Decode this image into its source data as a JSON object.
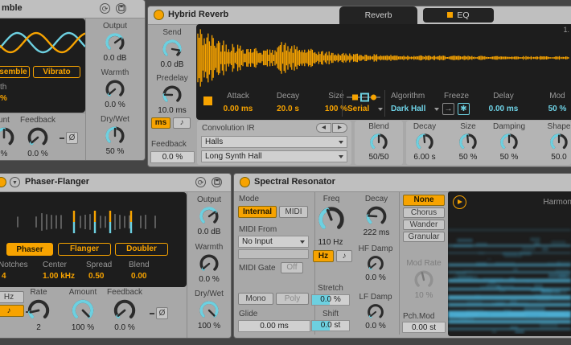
{
  "colors": {
    "orange": "#f7a300",
    "cyan": "#6dd0e0",
    "cyantext": "#6fd4e8",
    "bg": "#454545",
    "surface": "#a8a8a8",
    "titlebar": "#bfbfbf",
    "display": "#1d1d1d",
    "panel": "#b6b6b6",
    "field": "#d0d0d0"
  },
  "icons": {
    "hotswap": "⟳",
    "fold": "▼",
    "conv_prev": "◂",
    "conv_next": "▸"
  },
  "chorus": {
    "title": "mble",
    "ensemble_btn": "semble",
    "vibrato_btn": "Vibrato",
    "width_label": "th",
    "width_value": "%",
    "output": {
      "label": "Output",
      "value": "0.0 dB",
      "frac": 0.7
    },
    "warmth": {
      "label": "Warmth",
      "value": "0.0 %",
      "frac": 0.02
    },
    "drywet": {
      "label": "Dry/Wet",
      "value": "50 %",
      "frac": 0.5
    },
    "amount": {
      "label": "unt",
      "value": "%",
      "frac": 0.5
    },
    "feedback": {
      "label": "Feedback",
      "value": "0.0 %",
      "frac": 0.02
    },
    "phase_btn": "Ø"
  },
  "hybrid": {
    "title": "Hybrid Reverb",
    "tab_reverb": "Reverb",
    "tab_eq": "EQ",
    "send": {
      "label": "Send",
      "value": "0.0 dB",
      "frac": 0.87
    },
    "predelay": {
      "label": "Predelay",
      "value": "10.0 ms",
      "frac": 0.17
    },
    "ms_btn": "ms",
    "note_btn": "♪",
    "feedback_label": "Feedback",
    "feedback_value": "0.0 %",
    "ruler": "1.",
    "attack": {
      "label": "Attack",
      "value": "0.00 ms"
    },
    "decay": {
      "label": "Decay",
      "value": "20.0 s"
    },
    "size": {
      "label": "Size",
      "value": "100 %"
    },
    "routing_value": "Serial",
    "algorithm_label": "Algorithm",
    "algorithm_value": "Dark Hall",
    "freeze_label": "Freeze",
    "route_glyph": "→",
    "freeze_glyph": "✱",
    "delay_label": "Delay",
    "delay_value": "0.00 ms",
    "mod_label": "Mod",
    "mod_value": "50 %",
    "conv_label": "Convolution IR",
    "conv_category": "Halls",
    "conv_file": "Long Synth Hall",
    "blend": {
      "label": "Blend",
      "value": "50/50",
      "frac": 0.5
    },
    "decay2": {
      "label": "Decay",
      "value": "6.00 s",
      "frac": 0.48
    },
    "size2": {
      "label": "Size",
      "value": "50 %",
      "frac": 0.48
    },
    "damping": {
      "label": "Damping",
      "value": "50 %",
      "frac": 0.5
    },
    "shape": {
      "label": "Shape",
      "value": "50.0",
      "frac": 0.5
    }
  },
  "phaser": {
    "title": "Phaser-Flanger",
    "mode_phaser": "Phaser",
    "mode_flanger": "Flanger",
    "mode_doubler": "Doubler",
    "notches_label": "Notches",
    "notches_value": "4",
    "center_label": "Center",
    "center_value": "1.00 kHz",
    "spread_label": "Spread",
    "spread_value": "0.50",
    "blend_label": "Blend",
    "blend_value": "0.00",
    "hz_btn": "Hz",
    "note_btn": "♪",
    "rate": {
      "label": "Rate",
      "value": "2",
      "frac": 0.12
    },
    "amount": {
      "label": "Amount",
      "value": "100 %",
      "frac": 1
    },
    "feedback": {
      "label": "Feedback",
      "value": "0.0 %",
      "frac": 0.02
    },
    "phase_btn": "Ø",
    "output": {
      "label": "Output",
      "value": "0.0 dB",
      "frac": 0.7
    },
    "warmth": {
      "label": "Warmth",
      "value": "0.0 %",
      "frac": 0.02
    },
    "drywet": {
      "label": "Dry/Wet",
      "value": "100 %",
      "frac": 1
    }
  },
  "spectral": {
    "title": "Spectral Resonator",
    "mode_label": "Mode",
    "internal_btn": "Internal",
    "midi_btn": "MIDI",
    "midifrom_label": "MIDI From",
    "midifrom_value": "No Input",
    "midigate_label": "MIDI Gate",
    "midigate_value": "Off",
    "mono_btn": "Mono",
    "poly_btn": "Poly",
    "glide_label": "Glide",
    "glide_value": "0.00 ms",
    "freq": {
      "label": "Freq",
      "value": "110 Hz",
      "frac": 0.42
    },
    "hz_btn": "Hz",
    "note_btn": "♪",
    "decay": {
      "label": "Decay",
      "value": "222 ms",
      "frac": 0.18
    },
    "hfdamp": {
      "label": "HF Damp",
      "value": "0.0 %",
      "frac": 0.02
    },
    "lfdamp": {
      "label": "LF Damp",
      "value": "0.0 %",
      "frac": 0.02
    },
    "stretch_label": "Stretch",
    "stretch_value": "0.0 %",
    "shift_label": "Shift",
    "shift_value": "0.0 st",
    "mod_none": "None",
    "mod_chorus": "Chorus",
    "mod_wander": "Wander",
    "mod_granular": "Granular",
    "modrate": {
      "label": "Mod Rate",
      "value": "10 %",
      "frac": 0.45,
      "disabled": true
    },
    "pchmod_label": "Pch.Mod",
    "pchmod_value": "0.00 st",
    "display_title": "Harmon"
  }
}
